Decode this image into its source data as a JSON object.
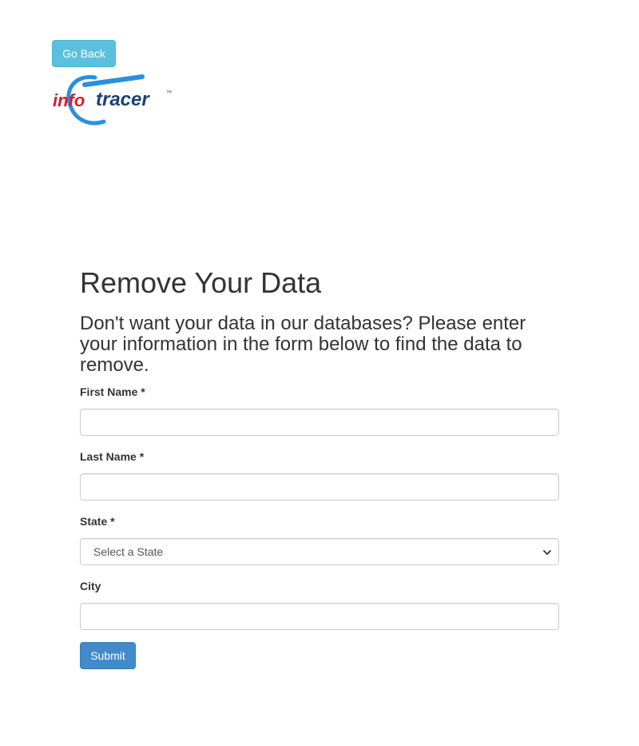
{
  "nav": {
    "go_back_label": "Go Back"
  },
  "logo": {
    "part1": "info",
    "part2": "tracer",
    "trademark": "™",
    "colors": {
      "info": "#d01f2b",
      "tracer": "#1d3f73",
      "swoosh": "#2b8fe0"
    }
  },
  "page": {
    "title": "Remove Your Data",
    "intro": "Don't want your data in our databases? Please enter your information in the form below to find the data to remove."
  },
  "form": {
    "first_name": {
      "label": "First Name *",
      "value": ""
    },
    "last_name": {
      "label": "Last Name *",
      "value": ""
    },
    "state": {
      "label": "State *",
      "selected": "Select a State",
      "icon": "chevron-down-icon"
    },
    "city": {
      "label": "City",
      "value": ""
    },
    "submit_label": "Submit"
  },
  "colors": {
    "go_back_bg": "#5bc0de",
    "submit_bg": "#428bca",
    "text": "#333333",
    "border": "#cccccc"
  }
}
